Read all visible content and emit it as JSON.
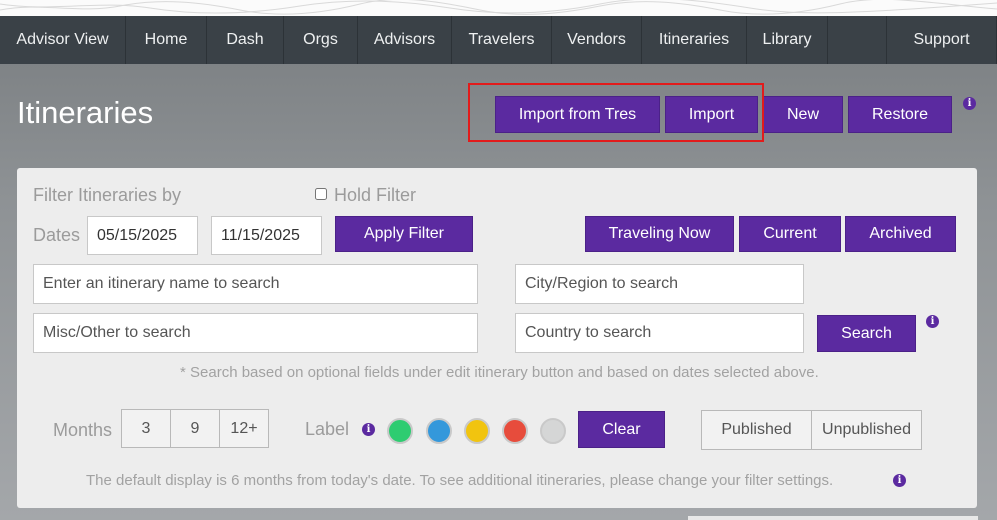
{
  "nav": {
    "items": [
      "Advisor View",
      "Home",
      "Dash",
      "Orgs",
      "Advisors",
      "Travelers",
      "Vendors",
      "Itineraries",
      "Library"
    ],
    "support": "Support"
  },
  "header": {
    "title": "Itineraries",
    "buttons": [
      "Import from Tres",
      "Import",
      "New",
      "Restore"
    ],
    "info_glyph": "i"
  },
  "filter": {
    "heading": "Filter Itineraries by",
    "hold_filter": "Hold Filter",
    "dates_label": "Dates",
    "start_date": "05/15/2025",
    "end_date": "11/15/2025",
    "apply": "Apply Filter",
    "status_buttons": [
      "Traveling Now",
      "Current",
      "Archived"
    ],
    "name_placeholder": "Enter an itinerary name to search",
    "city_placeholder": "City/Region to search",
    "misc_placeholder": "Misc/Other to search",
    "country_placeholder": "Country to search",
    "search": "Search",
    "search_note": "* Search based on optional fields under edit itinerary button and based on dates selected above.",
    "months_label": "Months",
    "months": [
      "3",
      "9",
      "12+"
    ],
    "label_label": "Label",
    "label_colors": [
      "#2ecc71",
      "#3498db",
      "#f1c40f",
      "#e74c3c",
      "#d5d6d6"
    ],
    "clear": "Clear",
    "published": "Published",
    "unpublished": "Unpublished",
    "default_note": "The default display is 6 months from today's date. To see additional itineraries, please change your filter settings."
  }
}
